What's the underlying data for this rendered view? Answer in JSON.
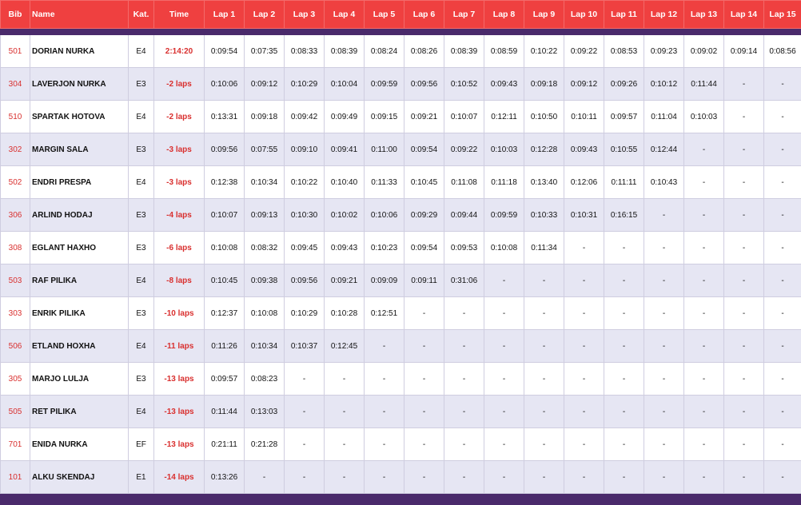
{
  "headers": [
    "Bib",
    "Name",
    "Kat.",
    "Time",
    "Lap 1",
    "Lap 2",
    "Lap 3",
    "Lap 4",
    "Lap 5",
    "Lap 6",
    "Lap 7",
    "Lap 8",
    "Lap 9",
    "Lap 10",
    "Lap 11",
    "Lap 12",
    "Lap 13",
    "Lap 14",
    "Lap 15"
  ],
  "rows": [
    {
      "bib": "501",
      "name": "DORIAN NURKA",
      "kat": "E4",
      "time": "2:14:20",
      "laps": [
        "0:09:54",
        "0:07:35",
        "0:08:33",
        "0:08:39",
        "0:08:24",
        "0:08:26",
        "0:08:39",
        "0:08:59",
        "0:10:22",
        "0:09:22",
        "0:08:53",
        "0:09:23",
        "0:09:02",
        "0:09:14",
        "0:08:56"
      ]
    },
    {
      "bib": "304",
      "name": "LAVERJON NURKA",
      "kat": "E3",
      "time": "-2 laps",
      "laps": [
        "0:10:06",
        "0:09:12",
        "0:10:29",
        "0:10:04",
        "0:09:59",
        "0:09:56",
        "0:10:52",
        "0:09:43",
        "0:09:18",
        "0:09:12",
        "0:09:26",
        "0:10:12",
        "0:11:44",
        "-",
        "-"
      ]
    },
    {
      "bib": "510",
      "name": "SPARTAK  HOTOVA",
      "kat": "E4",
      "time": "-2 laps",
      "laps": [
        "0:13:31",
        "0:09:18",
        "0:09:42",
        "0:09:49",
        "0:09:15",
        "0:09:21",
        "0:10:07",
        "0:12:11",
        "0:10:50",
        "0:10:11",
        "0:09:57",
        "0:11:04",
        "0:10:03",
        "-",
        "-"
      ]
    },
    {
      "bib": "302",
      "name": "MARGIN SALA",
      "kat": "E3",
      "time": "-3 laps",
      "laps": [
        "0:09:56",
        "0:07:55",
        "0:09:10",
        "0:09:41",
        "0:11:00",
        "0:09:54",
        "0:09:22",
        "0:10:03",
        "0:12:28",
        "0:09:43",
        "0:10:55",
        "0:12:44",
        "-",
        "-",
        "-"
      ]
    },
    {
      "bib": "502",
      "name": "ENDRI PRESPA",
      "kat": "E4",
      "time": "-3 laps",
      "laps": [
        "0:12:38",
        "0:10:34",
        "0:10:22",
        "0:10:40",
        "0:11:33",
        "0:10:45",
        "0:11:08",
        "0:11:18",
        "0:13:40",
        "0:12:06",
        "0:11:11",
        "0:10:43",
        "-",
        "-",
        "-"
      ]
    },
    {
      "bib": "306",
      "name": "ARLIND HODAJ",
      "kat": "E3",
      "time": "-4 laps",
      "laps": [
        "0:10:07",
        "0:09:13",
        "0:10:30",
        "0:10:02",
        "0:10:06",
        "0:09:29",
        "0:09:44",
        "0:09:59",
        "0:10:33",
        "0:10:31",
        "0:16:15",
        "-",
        "-",
        "-",
        "-"
      ]
    },
    {
      "bib": "308",
      "name": "EGLANT HAXHO",
      "kat": "E3",
      "time": "-6 laps",
      "laps": [
        "0:10:08",
        "0:08:32",
        "0:09:45",
        "0:09:43",
        "0:10:23",
        "0:09:54",
        "0:09:53",
        "0:10:08",
        "0:11:34",
        "-",
        "-",
        "-",
        "-",
        "-",
        "-"
      ]
    },
    {
      "bib": "503",
      "name": "RAF PILIKA",
      "kat": "E4",
      "time": "-8 laps",
      "laps": [
        "0:10:45",
        "0:09:38",
        "0:09:56",
        "0:09:21",
        "0:09:09",
        "0:09:11",
        "0:31:06",
        "-",
        "-",
        "-",
        "-",
        "-",
        "-",
        "-",
        "-"
      ]
    },
    {
      "bib": "303",
      "name": "ENRIK PILIKA",
      "kat": "E3",
      "time": "-10 laps",
      "laps": [
        "0:12:37",
        "0:10:08",
        "0:10:29",
        "0:10:28",
        "0:12:51",
        "-",
        "-",
        "-",
        "-",
        "-",
        "-",
        "-",
        "-",
        "-",
        "-"
      ]
    },
    {
      "bib": "506",
      "name": "ETLAND HOXHA",
      "kat": "E4",
      "time": "-11 laps",
      "laps": [
        "0:11:26",
        "0:10:34",
        "0:10:37",
        "0:12:45",
        "-",
        "-",
        "-",
        "-",
        "-",
        "-",
        "-",
        "-",
        "-",
        "-",
        "-"
      ]
    },
    {
      "bib": "305",
      "name": "MARJO LULJA",
      "kat": "E3",
      "time": "-13 laps",
      "laps": [
        "0:09:57",
        "0:08:23",
        "-",
        "-",
        "-",
        "-",
        "-",
        "-",
        "-",
        "-",
        "-",
        "-",
        "-",
        "-",
        "-"
      ]
    },
    {
      "bib": "505",
      "name": "RET PILIKA",
      "kat": "E4",
      "time": "-13 laps",
      "laps": [
        "0:11:44",
        "0:13:03",
        "-",
        "-",
        "-",
        "-",
        "-",
        "-",
        "-",
        "-",
        "-",
        "-",
        "-",
        "-",
        "-"
      ]
    },
    {
      "bib": "701",
      "name": "ENIDA NURKA",
      "kat": "EF",
      "time": "-13 laps",
      "laps": [
        "0:21:11",
        "0:21:28",
        "-",
        "-",
        "-",
        "-",
        "-",
        "-",
        "-",
        "-",
        "-",
        "-",
        "-",
        "-",
        "-"
      ]
    },
    {
      "bib": "101",
      "name": "ALKU SKENDAJ",
      "kat": "E1",
      "time": "-14 laps",
      "laps": [
        "0:13:26",
        "-",
        "-",
        "-",
        "-",
        "-",
        "-",
        "-",
        "-",
        "-",
        "-",
        "-",
        "-",
        "-",
        "-"
      ]
    }
  ],
  "colors": {
    "header_bg": "#ef4040",
    "band": "#4a2a6b",
    "row_alt": "#e6e6f3",
    "accent_text": "#d9302f"
  }
}
